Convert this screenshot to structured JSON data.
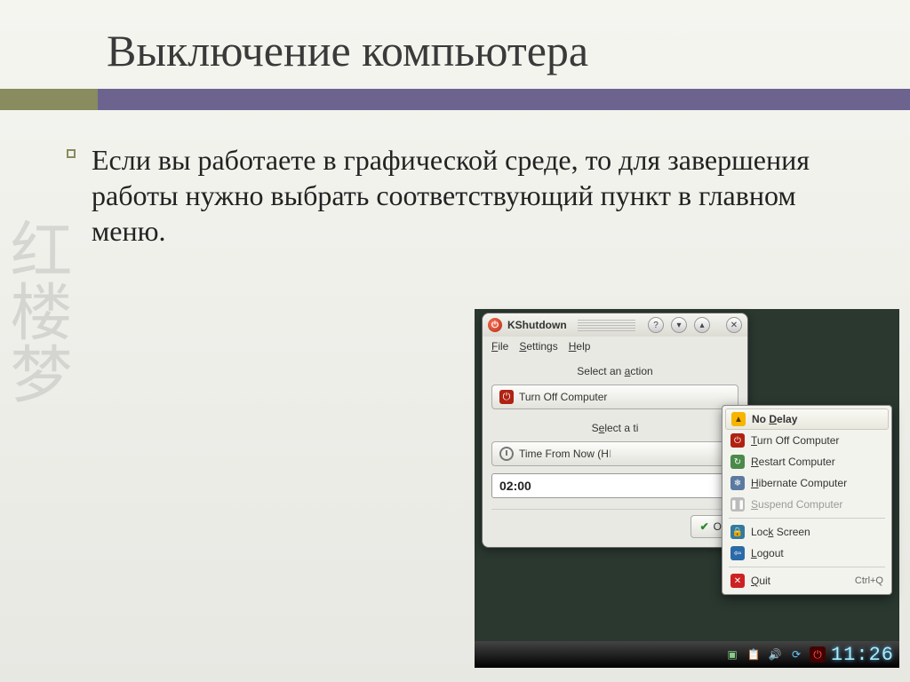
{
  "slide": {
    "title": "Выключение компьютера",
    "body": "Если вы работаете в графической среде, то для завершения работы нужно выбрать соответствующий пункт в главном меню."
  },
  "kshutdown": {
    "window_title": "KShutdown",
    "menu": {
      "file": "File",
      "settings": "Settings",
      "help": "Help"
    },
    "label_select_action": "Select an action",
    "btn_turn_off": "Turn Off Computer",
    "label_select_time": "Select a ti",
    "btn_time_from_now": "Time From Now (H",
    "time_value": "02:00",
    "ok": "OK"
  },
  "context_menu": {
    "no_delay": "No Delay",
    "turn_off": "Turn Off Computer",
    "restart": "Restart Computer",
    "hibernate": "Hibernate Computer",
    "suspend": "Suspend Computer",
    "lock": "Lock Screen",
    "logout": "Logout",
    "quit": "Quit",
    "quit_accel": "Ctrl+Q"
  },
  "taskbar": {
    "clock": "11:26"
  }
}
